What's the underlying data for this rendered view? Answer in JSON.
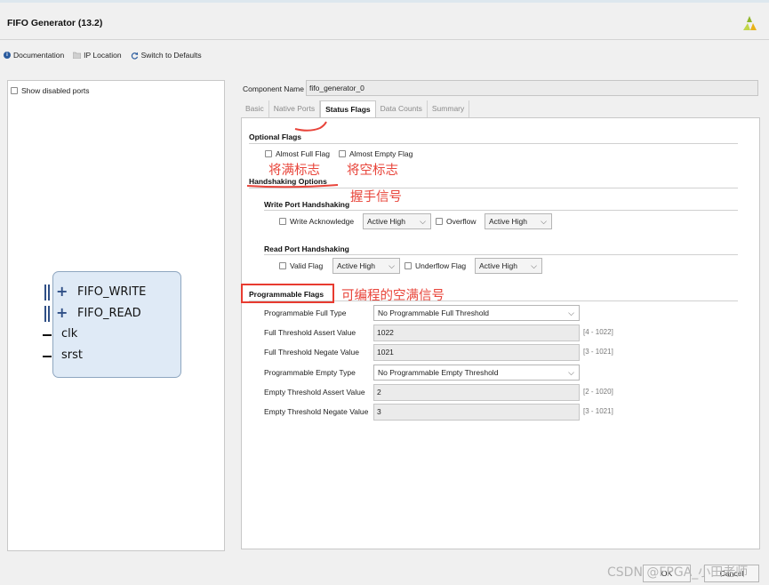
{
  "window": {
    "title": "FIFO Generator (13.2)"
  },
  "toolbar": {
    "documentation": "Documentation",
    "ip_location": "IP Location",
    "switch_defaults": "Switch to Defaults"
  },
  "left_panel": {
    "show_disabled_ports": "Show disabled ports",
    "ports": {
      "fifo_write": "FIFO_WRITE",
      "fifo_read": "FIFO_READ",
      "clk": "clk",
      "srst": "srst"
    }
  },
  "component": {
    "label": "Component Name",
    "value": "fifo_generator_0"
  },
  "tabs": [
    "Basic",
    "Native Ports",
    "Status Flags",
    "Data Counts",
    "Summary"
  ],
  "optional_flags": {
    "title": "Optional Flags",
    "almost_full": "Almost Full Flag",
    "almost_empty": "Almost Empty Flag"
  },
  "handshaking": {
    "title": "Handshaking Options",
    "write_title": "Write Port Handshaking",
    "write_ack": "Write Acknowledge",
    "write_ack_sel": "Active High",
    "overflow": "Overflow",
    "overflow_sel": "Active High",
    "read_title": "Read Port Handshaking",
    "valid": "Valid Flag",
    "valid_sel": "Active High",
    "underflow": "Underflow Flag",
    "underflow_sel": "Active High"
  },
  "programmable": {
    "title": "Programmable Flags",
    "full_type_label": "Programmable Full Type",
    "full_type_value": "No Programmable Full Threshold",
    "full_assert_label": "Full Threshold Assert Value",
    "full_assert_value": "1022",
    "full_assert_range": "[4 - 1022]",
    "full_negate_label": "Full Threshold Negate Value",
    "full_negate_value": "1021",
    "full_negate_range": "[3 - 1021]",
    "empty_type_label": "Programmable Empty Type",
    "empty_type_value": "No Programmable Empty Threshold",
    "empty_assert_label": "Empty Threshold Assert Value",
    "empty_assert_value": "2",
    "empty_assert_range": "[2 - 1020]",
    "empty_negate_label": "Empty Threshold Negate Value",
    "empty_negate_value": "3",
    "empty_negate_range": "[3 - 1021]"
  },
  "annotations": {
    "almost_full": "将满标志",
    "almost_empty": "将空标志",
    "handshake": "握手信号",
    "programmable": "可编程的空满信号"
  },
  "footer": {
    "ok": "OK",
    "cancel": "Cancel"
  },
  "watermark": "CSDN @FPGA_小田老师",
  "colors": {
    "annotation": "#e8443a",
    "accent": "#2f4f86"
  }
}
